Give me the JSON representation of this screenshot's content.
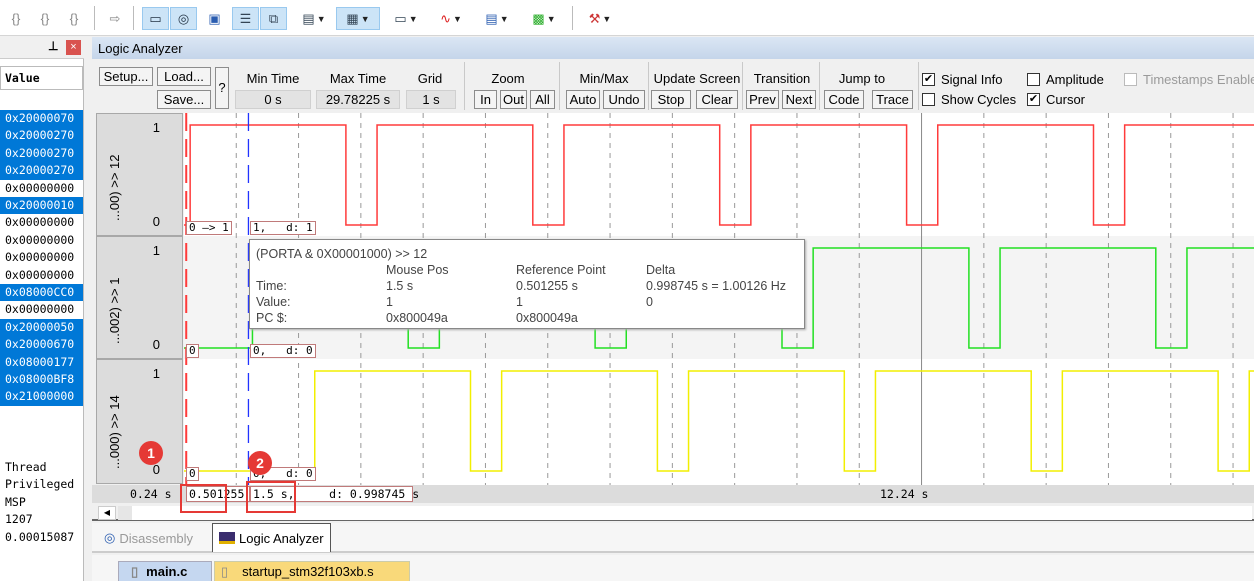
{
  "toolbar": {
    "icons": [
      "step-into-icon",
      "step-over-icon",
      "step-out-icon",
      "run-to-cursor-icon",
      "command-window-icon",
      "disassembly-window-icon",
      "symbols-window-icon",
      "registers-window-icon",
      "call-stack-icon",
      "watch-window-icon",
      "memory-window-icon",
      "serial-window-icon",
      "analysis-window-icon",
      "trace-window-icon",
      "system-viewer-icon",
      "toolbox-icon"
    ]
  },
  "left_panel": {
    "header": "Value",
    "values": [
      {
        "v": "0x20000070",
        "sel": true
      },
      {
        "v": "0x20000270",
        "sel": true
      },
      {
        "v": "0x20000270",
        "sel": true
      },
      {
        "v": "0x20000270",
        "sel": true
      },
      {
        "v": "0x00000000",
        "sel": false
      },
      {
        "v": "0x20000010",
        "sel": true
      },
      {
        "v": "0x00000000",
        "sel": false
      },
      {
        "v": "0x00000000",
        "sel": false
      },
      {
        "v": "0x00000000",
        "sel": false
      },
      {
        "v": "0x00000000",
        "sel": false
      },
      {
        "v": "0x08000CC0",
        "sel": true
      },
      {
        "v": "0x00000000",
        "sel": false
      },
      {
        "v": "0x20000050",
        "sel": true
      },
      {
        "v": "0x20000670",
        "sel": true
      },
      {
        "v": "0x08000177",
        "sel": true
      },
      {
        "v": "0x08000BF8",
        "sel": true
      },
      {
        "v": "0x21000000",
        "sel": true
      }
    ],
    "extra": [
      "Thread",
      "Privileged",
      "MSP",
      "1207",
      "0.00015087"
    ]
  },
  "window_title": "Logic Analyzer",
  "controls": {
    "setup": "Setup...",
    "load": "Load...",
    "save": "Save...",
    "help": "?",
    "min_time_label": "Min Time",
    "min_time": "0 s",
    "max_time_label": "Max Time",
    "max_time": "29.78225 s",
    "grid_label": "Grid",
    "grid": "1 s",
    "zoom_label": "Zoom",
    "zoom_in": "In",
    "zoom_out": "Out",
    "zoom_all": "All",
    "minmax_label": "Min/Max",
    "auto": "Auto",
    "undo": "Undo",
    "update_label": "Update Screen",
    "stop": "Stop",
    "clear": "Clear",
    "transition_label": "Transition",
    "prev": "Prev",
    "next": "Next",
    "jump_label": "Jump to",
    "code": "Code",
    "trace": "Trace",
    "signal_info": "Signal Info",
    "amplitude": "Amplitude",
    "timestamps": "Timestamps Enable",
    "show_cycles": "Show Cycles",
    "cursor": "Cursor",
    "signal_info_checked": true,
    "amplitude_checked": false,
    "timestamps_checked": false,
    "show_cycles_checked": false,
    "cursor_checked": true
  },
  "channels": [
    {
      "name": "...00) >> 12",
      "hi": "1",
      "lo": "0",
      "color": "#ff3b3b",
      "initial": 0,
      "transitions": [
        0.5,
        3,
        3.5,
        6,
        6.5,
        9,
        9.5,
        12,
        12.5,
        15,
        15.5
      ],
      "ref_label": "0 —> 1",
      "cur_label": "1,   d: 1"
    },
    {
      "name": "...002) >> 1",
      "hi": "1",
      "lo": "0",
      "color": "#22e022",
      "initial": 0,
      "transitions": [
        1.5,
        4,
        4.5,
        7,
        7.5,
        10,
        10.5,
        13,
        13.5,
        16,
        16.5
      ],
      "ref_label": "0",
      "cur_label": "0,   d: 0"
    },
    {
      "name": "...000) >> 14",
      "hi": "1",
      "lo": "0",
      "color": "#f2ef00",
      "initial": 0,
      "transitions": [
        2.5,
        5,
        5.5,
        8,
        8.5,
        11,
        11.5,
        14,
        14.5,
        17,
        17.5
      ],
      "ref_label": "0",
      "cur_label": "0,   d: 0"
    }
  ],
  "cursors": {
    "reference_time": 0.501255,
    "mouse_time": 1.5,
    "reference_color": "#ff3b3b",
    "mouse_color": "#2233ff"
  },
  "tooltip": {
    "title": "(PORTA & 0X00001000) >> 12",
    "col_mouse": "Mouse Pos",
    "col_ref": "Reference Point",
    "col_delta": "Delta",
    "time_label": "Time:",
    "value_label": "Value:",
    "pc_label": "PC $:",
    "time_mouse": "1.5 s",
    "time_ref": "0.501255 s",
    "time_delta": "0.998745 s = 1.00126 Hz",
    "value_mouse": "1",
    "value_ref": "1",
    "value_delta": "0",
    "pc_mouse": "0x800049a",
    "pc_ref": "0x800049a"
  },
  "timeline": {
    "left": "0.24 s",
    "ref": "0.501255",
    "cursor": "1.5 s,     d: 0.998745 s",
    "mid": "12.24 s"
  },
  "annotations": {
    "m1": "1",
    "m2": "2"
  },
  "bottom_tabs": {
    "disassembly": "Disassembly",
    "logic": "Logic Analyzer"
  },
  "editor_tabs": {
    "main": "main.c",
    "startup": "startup_stm32f103xb.s"
  }
}
